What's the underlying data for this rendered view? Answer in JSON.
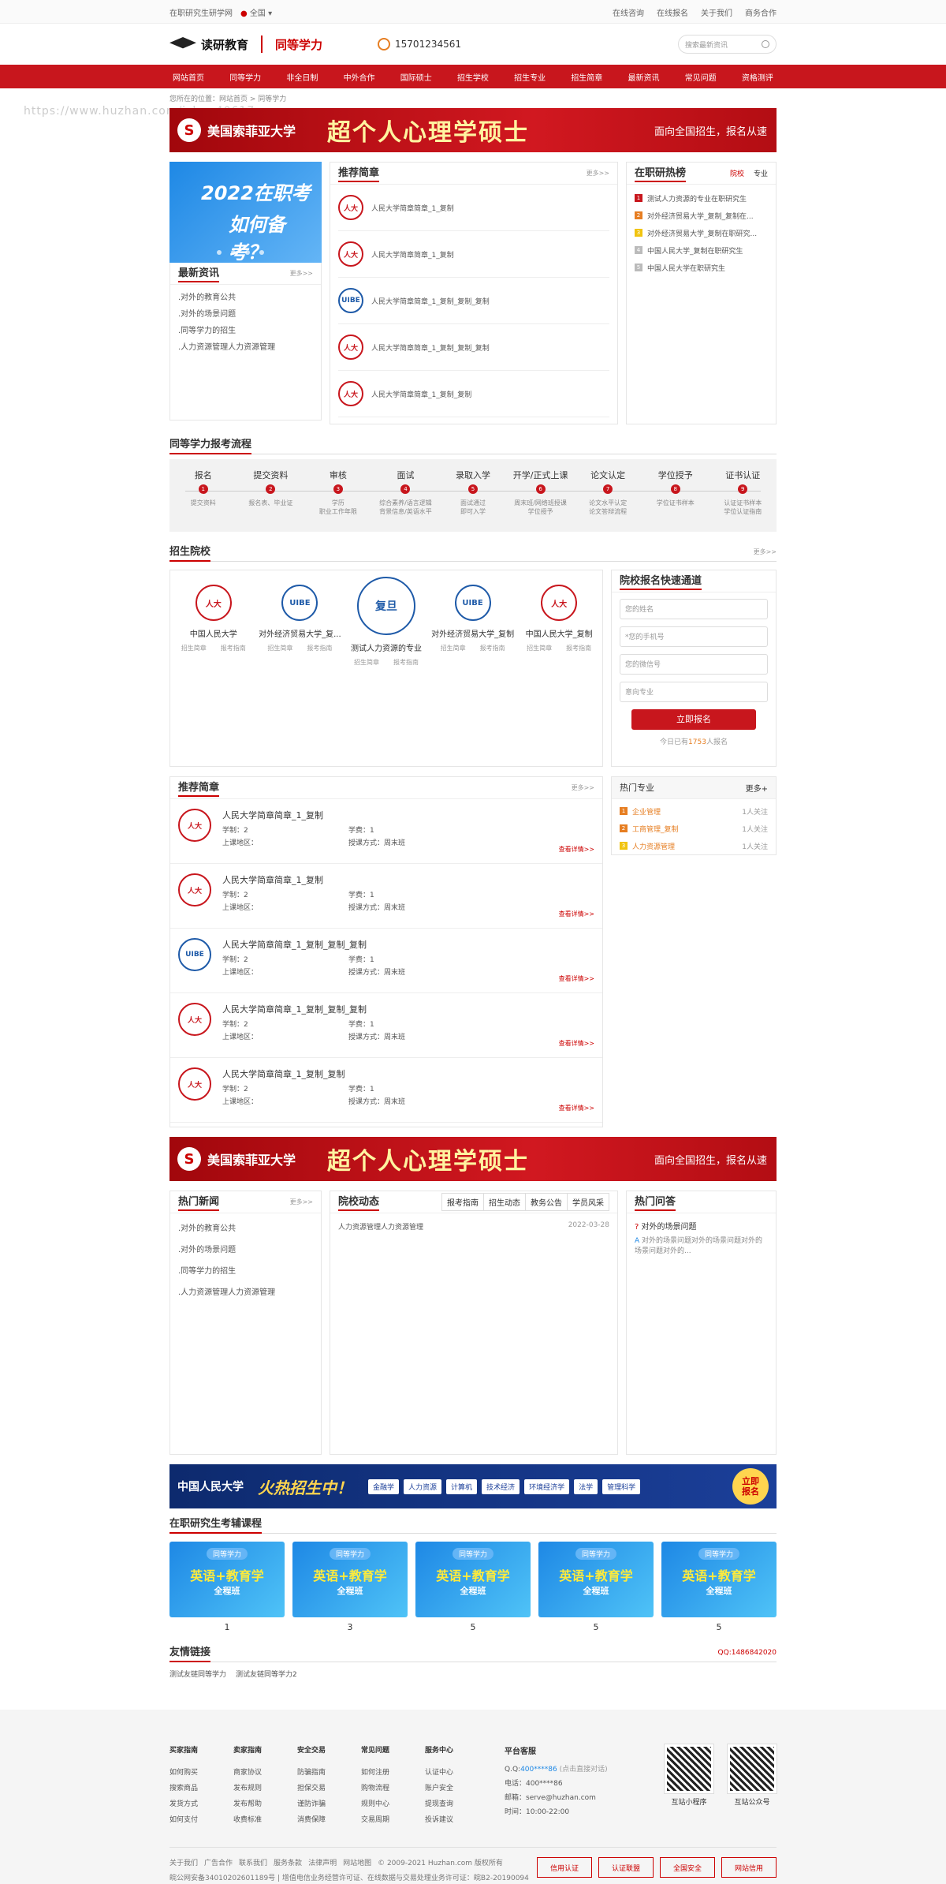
{
  "topbar": {
    "site_name": "在职研究生研学网",
    "region": "全国",
    "links": [
      "在线咨询",
      "在线报名",
      "关于我们",
      "商务合作"
    ]
  },
  "header": {
    "logo_text": "读研教育",
    "logo_sub": "同等学力",
    "phone": "15701234561",
    "search_placeholder": "搜索最新资讯"
  },
  "nav": [
    "网站首页",
    "同等学力",
    "非全日制",
    "中外合作",
    "国际硕士",
    "招生学校",
    "招生专业",
    "招生简章",
    "最新资讯",
    "常见问题",
    "资格测评"
  ],
  "breadcrumb": "您所在的位置：网站首页 > 同等学力",
  "watermark": "https://www.huzhan.com/ishop40617",
  "banner": {
    "uni": "美国索菲亚大学",
    "big": "超个人心理学硕士",
    "tag": "面向全国招生，报名从速",
    "logo": "S"
  },
  "slide": {
    "line1": "2022在职考",
    "line2": "如何备考？"
  },
  "latest_news": {
    "title": "最新资讯",
    "more": "更多>>",
    "items": [
      ".对外的教育公共",
      ".对外的场景问题",
      ".同等学力的招生",
      ".人力资源管理人力资源管理"
    ]
  },
  "rec_briefs": {
    "title": "推荐简章",
    "more": "更多>>",
    "items": [
      "人民大学简章简章_1_复制",
      "人民大学简章简章_1_复制",
      "人民大学简章简章_1_复制_复制_复制",
      "人民大学简章简章_1_复制_复制_复制",
      "人民大学简章简章_1_复制_复制"
    ]
  },
  "hot_rank": {
    "title": "在职研热榜",
    "tabs": [
      "院校",
      "专业"
    ],
    "items": [
      "测试人力资源的专业在职研究生",
      "对外经济贸易大学_复制_复制在...",
      "对外经济贸易大学_复制在职研究...",
      "中国人民大学_复制在职研究生",
      "中国人民大学在职研究生"
    ],
    "colors": [
      "#c8161d",
      "#e67e22",
      "#f1c40f",
      "#bbbbbb",
      "#bbbbbb"
    ]
  },
  "process": {
    "title": "同等学力报考流程",
    "steps": [
      {
        "n": "报名",
        "d": "提交资料"
      },
      {
        "n": "提交资料",
        "d": "报名表、毕业证"
      },
      {
        "n": "审核",
        "d": "学历\n职业工作年限"
      },
      {
        "n": "面试",
        "d": "综合素养/语言逻辑\n背景信息/英语水平"
      },
      {
        "n": "录取入学",
        "d": "面试通过\n即可入学"
      },
      {
        "n": "开学/正式上课",
        "d": "周末班/网络班授课\n学位授予"
      },
      {
        "n": "论文认定",
        "d": "论文水平认定\n论文答辩流程"
      },
      {
        "n": "学位授予",
        "d": "学位证书样本"
      },
      {
        "n": "证书认证",
        "d": "认证证书样本\n学位认证指南"
      }
    ]
  },
  "schools": {
    "title": "招生院校",
    "more": "更多>>",
    "items": [
      {
        "name": "中国人民大学",
        "seal": "人大"
      },
      {
        "name": "对外经济贸易大学_复...",
        "seal": "UIBE"
      },
      {
        "name": "测试人力资源的专业",
        "seal": "复旦"
      },
      {
        "name": "对外经济贸易大学_复制",
        "seal": "UIBE"
      },
      {
        "name": "中国人民大学_复制",
        "seal": "人大"
      }
    ],
    "link1": "招生简章",
    "link2": "报考指南"
  },
  "quick_form": {
    "title": "院校报名快速通道",
    "fields": [
      "您的姓名",
      "*您的手机号",
      "您的微信号",
      "意向专业"
    ],
    "button": "立即报名",
    "count_pre": "今日已有",
    "count": "1753",
    "count_suf": "人报名"
  },
  "rec_briefs2": {
    "title": "推荐简章",
    "more": "更多>>",
    "items": [
      "人民大学简章简章_1_复制",
      "人民大学简章简章_1_复制",
      "人民大学简章简章_1_复制_复制_复制",
      "人民大学简章简章_1_复制_复制_复制",
      "人民大学简章简章_1_复制_复制"
    ],
    "labels": {
      "xuezhi": "学制：",
      "xuezhi_v": "2",
      "xuefei": "学费：",
      "xuefei_v": "1",
      "place": "上课地区：",
      "mode": "授课方式：",
      "mode_v": "周末班",
      "detail": "查看详情>>"
    }
  },
  "hot_majors": {
    "title": "热门专业",
    "more": "更多+",
    "items": [
      {
        "n": "企业管理",
        "f": "1人关注"
      },
      {
        "n": "工商管理_复制",
        "f": "1人关注"
      },
      {
        "n": "人力资源管理",
        "f": "1人关注"
      }
    ]
  },
  "hot_news": {
    "title": "热门新闻",
    "more": "更多>>",
    "items": [
      ".对外的教育公共",
      ".对外的场景问题",
      ".同等学力的招生",
      ".人力资源管理人力资源管理"
    ]
  },
  "dynamics": {
    "title": "院校动态",
    "tabs": [
      "报考指南",
      "招生动态",
      "教务公告",
      "学员风采"
    ],
    "item": "人力资源管理人力资源管理",
    "date": "2022-03-28"
  },
  "hot_qa": {
    "title": "热门问答",
    "q": "对外的场景问题",
    "a": "对外的场景问题对外的场景问题对外的场景问题对外的..."
  },
  "cta": {
    "logo": "中国人民大学",
    "hot": "火热招生中！",
    "chips": [
      "金融学",
      "人力资源",
      "计算机",
      "技术经济",
      "环境经济学",
      "法学",
      "管理科学"
    ],
    "go": "立即\n报名"
  },
  "courses": {
    "title": "在职研究生考辅课程",
    "badge": "同等学力",
    "main": "英语+教育学",
    "sub": "全程班",
    "counts": [
      "1",
      "3",
      "5",
      "5",
      "5"
    ]
  },
  "friends": {
    "title": "友情链接",
    "qq": "QQ:1486842020",
    "links": [
      "测试友链同等学力",
      "测试友链同等学力2"
    ]
  },
  "footer": {
    "cols": [
      {
        "h": "买家指南",
        "items": [
          "如何购买",
          "搜索商品",
          "发货方式",
          "如何支付"
        ]
      },
      {
        "h": "卖家指南",
        "items": [
          "商家协议",
          "发布规则",
          "发布帮助",
          "收费标准"
        ]
      },
      {
        "h": "安全交易",
        "items": [
          "防骗指南",
          "担保交易",
          "谨防诈骗",
          "消费保障"
        ]
      },
      {
        "h": "常见问题",
        "items": [
          "如何注册",
          "购物流程",
          "规则中心",
          "交易周期"
        ]
      },
      {
        "h": "服务中心",
        "items": [
          "认证中心",
          "账户安全",
          "提现查询",
          "投诉建议"
        ]
      }
    ],
    "svc": {
      "h": "平台客服",
      "qq_label": "Q.Q:",
      "qq": "400****86",
      "qq_note": "(点击直接对话)",
      "tel": "电话：400****86",
      "mail": "邮箱：serve@huzhan.com",
      "time": "时间：10:00-22:00"
    },
    "qr1": "互站小程序",
    "qr2": "互站公众号",
    "bottom_links": [
      "关于我们",
      "广告合作",
      "联系我们",
      "服务条款",
      "法律声明",
      "网站地图"
    ],
    "copyright": "© 2009-2021 Huzhan.com 版权所有",
    "icp": "皖公网安备34010202601189号 | 增值电信业务经营许可证、在线数据与交易处理业务许可证：皖B2-20190094",
    "badges": [
      "信用认证",
      "认证联盟",
      "全国安全",
      "网站信用"
    ]
  }
}
